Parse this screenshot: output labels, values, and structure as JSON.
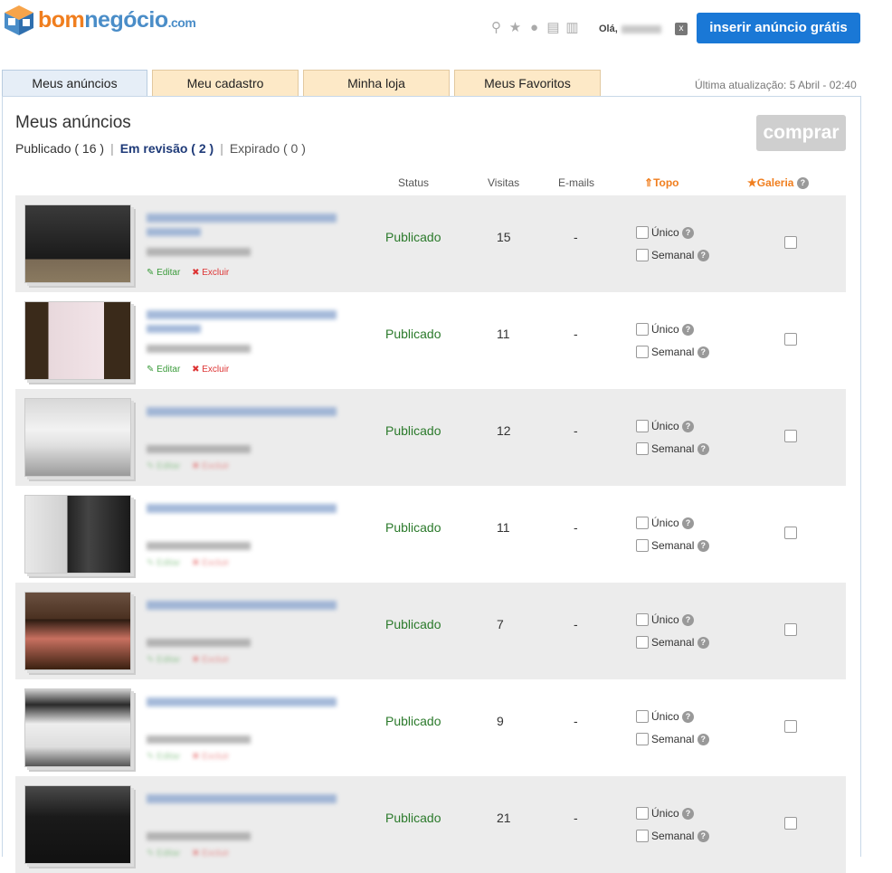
{
  "header": {
    "logo_part1": "bom",
    "logo_part2": "negócio",
    "logo_domain": ".com",
    "greeting": "Olá,",
    "close_label": "x",
    "insert_button": "inserir anúncio grátis"
  },
  "tabs": [
    {
      "label": "Meus anúncios"
    },
    {
      "label": "Meu cadastro"
    },
    {
      "label": "Minha loja"
    },
    {
      "label": "Meus Favoritos"
    }
  ],
  "last_update": "Última atualização: 5 Abril - 02:40",
  "panel": {
    "title": "Meus anúncios",
    "filters": {
      "published": "Publicado ( 16 )",
      "in_review": "Em revisão ( 2 )",
      "expired": "Expirado ( 0 )"
    },
    "buy_button": "comprar"
  },
  "columns": {
    "status": "Status",
    "visits": "Visitas",
    "emails": "E-mails",
    "topo": "Topo",
    "galeria": "Galeria"
  },
  "options": {
    "unico": "Único",
    "semanal": "Semanal"
  },
  "actions": {
    "edit": "Editar",
    "delete": "Excluir"
  },
  "ads": [
    {
      "status": "Publicado",
      "visits": "15",
      "emails": "-"
    },
    {
      "status": "Publicado",
      "visits": "11",
      "emails": "-"
    },
    {
      "status": "Publicado",
      "visits": "12",
      "emails": "-"
    },
    {
      "status": "Publicado",
      "visits": "11",
      "emails": "-"
    },
    {
      "status": "Publicado",
      "visits": "7",
      "emails": "-"
    },
    {
      "status": "Publicado",
      "visits": "9",
      "emails": "-"
    },
    {
      "status": "Publicado",
      "visits": "21",
      "emails": "-"
    }
  ],
  "colors": {
    "accent_blue": "#1a78d6",
    "orange": "#f07e1e",
    "status_green": "#2b7a2b"
  }
}
